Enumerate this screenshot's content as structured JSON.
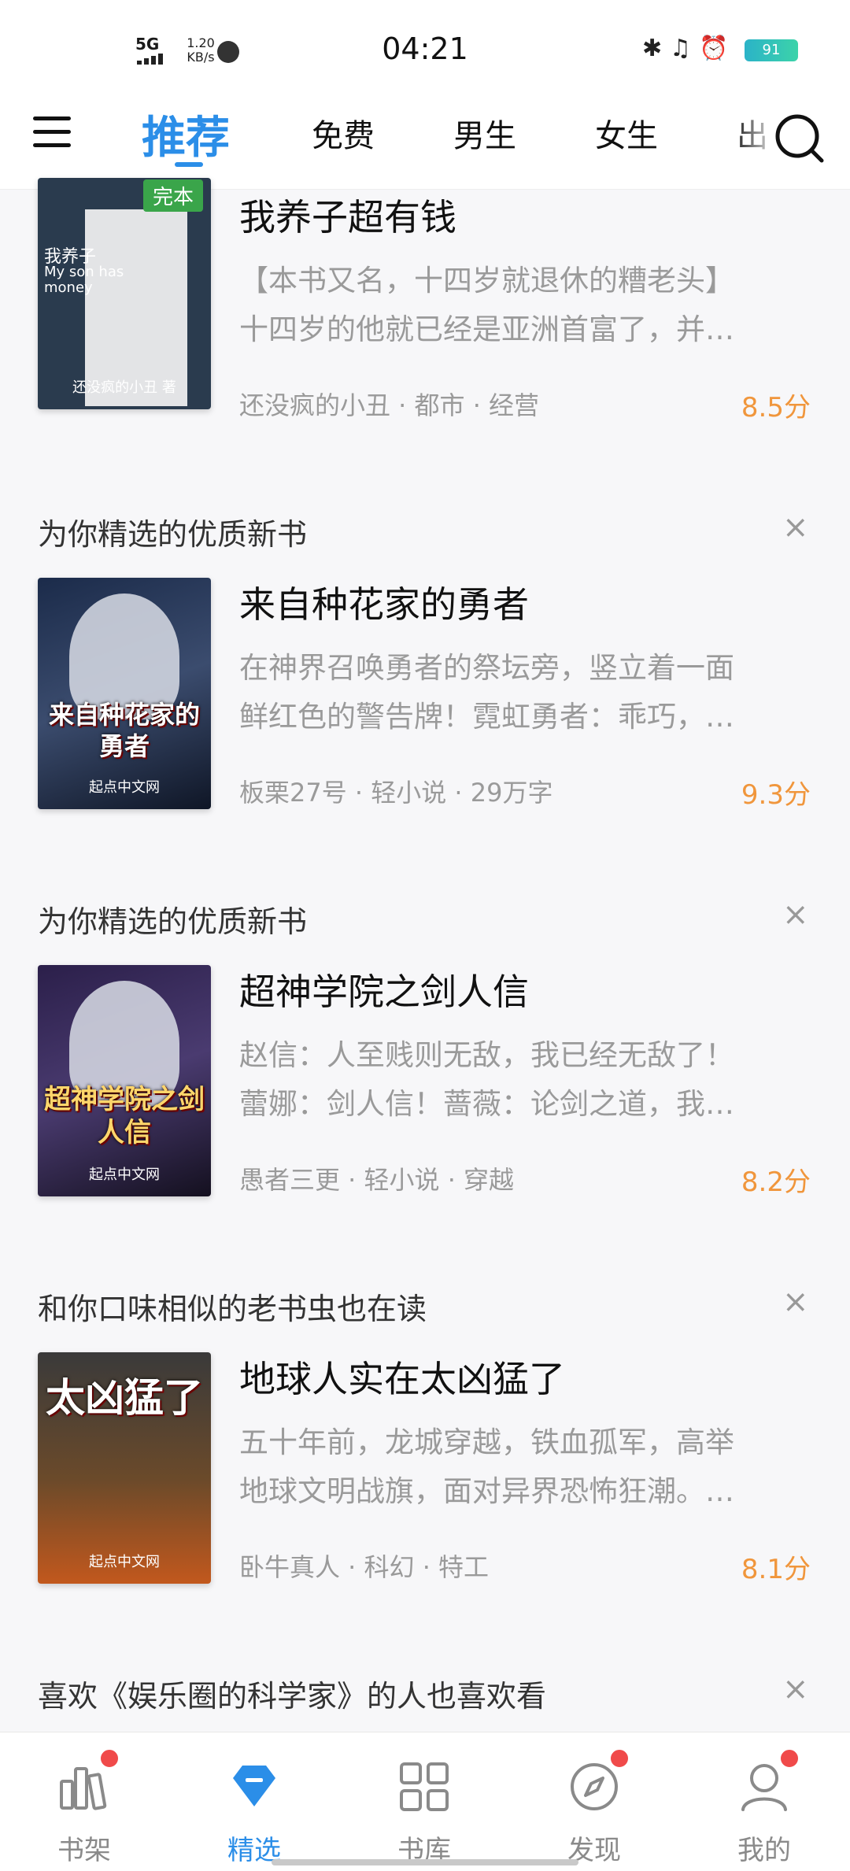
{
  "status": {
    "network": "5G",
    "speed_value": "1.20",
    "speed_unit": "KB/s",
    "time": "04:21",
    "battery": "91"
  },
  "topnav": {
    "tabs": [
      "推荐",
      "免费",
      "男生",
      "女生",
      "出"
    ]
  },
  "feed": [
    {
      "section": "",
      "title": "我养子超有钱",
      "desc_line1": "【本书又名，十四岁就退休的糟老头】",
      "desc_line2": "十四岁的他就已经是亚洲首富了，并…",
      "meta": "还没疯的小丑 · 都市 · 经营",
      "score": "8.5分",
      "cover_title": "我养子",
      "cover_title2": "My son has money",
      "cover_author": "还没疯的小丑 著",
      "cover_badge": "完本"
    },
    {
      "section": "为你精选的优质新书",
      "title": "来自种花家的勇者",
      "desc_line1": "在神界召唤勇者的祭坛旁，竖立着一面",
      "desc_line2": "鲜红色的警告牌！霓虹勇者：乖巧，…",
      "meta": "板栗27号 · 轻小说 · 29万字",
      "score": "9.3分",
      "cover_title": "来自种花家的勇者",
      "cover_author": "起点中文网"
    },
    {
      "section": "为你精选的优质新书",
      "title": "超神学院之剑人信",
      "desc_line1": "赵信：人至贱则无敌，我已经无敌了！",
      "desc_line2": "蕾娜：剑人信！蔷薇：论剑之道，我…",
      "meta": "愚者三更 · 轻小说 · 穿越",
      "score": "8.2分",
      "cover_title": "超神学院之剑人信",
      "cover_author": "起点中文网"
    },
    {
      "section": "和你口味相似的老书虫也在读",
      "title": "地球人实在太凶猛了",
      "desc_line1": "五十年前，龙城穿越，铁血孤军，高举",
      "desc_line2": "地球文明战旗，面对异界恐怖狂潮。…",
      "meta": "卧牛真人 · 科幻 · 特工",
      "score": "8.1分",
      "cover_title": "太凶猛了",
      "cover_author": "起点中文网"
    }
  ],
  "last_section": "喜欢《娱乐圈的科学家》的人也喜欢看",
  "bottomnav": {
    "items": [
      "书架",
      "精选",
      "书库",
      "发现",
      "我的"
    ]
  },
  "colors": {
    "accent": "#2b8ee8",
    "score": "#f0963c",
    "badge": "#3aa54a",
    "dot": "#f04a4a"
  }
}
